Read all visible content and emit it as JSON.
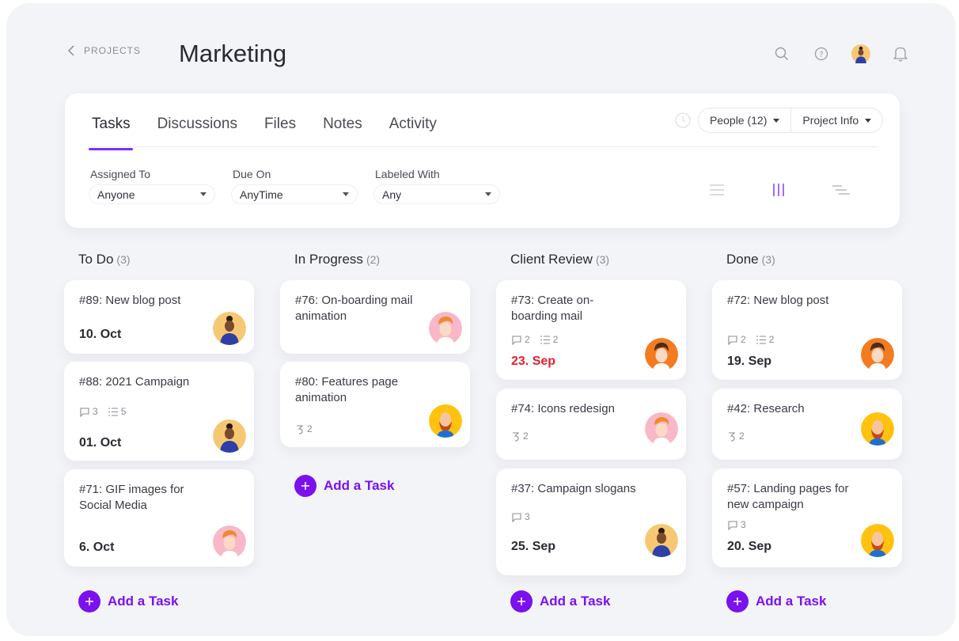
{
  "header": {
    "back_label": "PROJECTS",
    "title": "Marketing"
  },
  "tabs": [
    {
      "label": "Tasks"
    },
    {
      "label": "Discussions"
    },
    {
      "label": "Files"
    },
    {
      "label": "Notes"
    },
    {
      "label": "Activity"
    }
  ],
  "controls": {
    "people_label": "People (12)",
    "project_info_label": "Project Info"
  },
  "filters": {
    "assigned": {
      "label": "Assigned To",
      "value": "Anyone"
    },
    "due": {
      "label": "Due On",
      "value": "AnyTime"
    },
    "labeled": {
      "label": "Labeled With",
      "value": "Any"
    }
  },
  "add_task_label": "Add a Task",
  "columns": {
    "todo": {
      "name": "To Do",
      "count": "(3)",
      "cards": [
        {
          "title": "#89: New blog post",
          "due": "10. Oct"
        },
        {
          "title": "#88: 2021 Campaign",
          "comments": "3",
          "subtasks": "5",
          "due": "01. Oct"
        },
        {
          "title": "#71: GIF images for Social Media",
          "due": "6. Oct"
        }
      ]
    },
    "progress": {
      "name": "In Progress",
      "count": "(2)",
      "cards": [
        {
          "title": "#76: On-boarding mail animation"
        },
        {
          "title": "#80: Features page animation",
          "links": "2"
        }
      ]
    },
    "review": {
      "name": "Client Review",
      "count": "(3)",
      "cards": [
        {
          "title": "#73: Create on-boarding mail",
          "comments": "2",
          "subtasks": "2",
          "due": "23. Sep"
        },
        {
          "title": "#74: Icons redesign",
          "links": "2"
        },
        {
          "title": "#37: Campaign slogans",
          "comments": "3",
          "due": "25. Sep"
        }
      ]
    },
    "done": {
      "name": "Done",
      "count": "(3)",
      "cards": [
        {
          "title": "#72: New blog post",
          "comments": "2",
          "subtasks": "2",
          "due": "19. Sep"
        },
        {
          "title": "#42: Research",
          "links": "2"
        },
        {
          "title": "#57: Landing pages for new campaign",
          "comments": "3",
          "due": "20. Sep"
        }
      ]
    }
  },
  "colors": {
    "accent": "#7a11ee",
    "overdue": "#e8202e",
    "background": "#f3f4f7"
  }
}
